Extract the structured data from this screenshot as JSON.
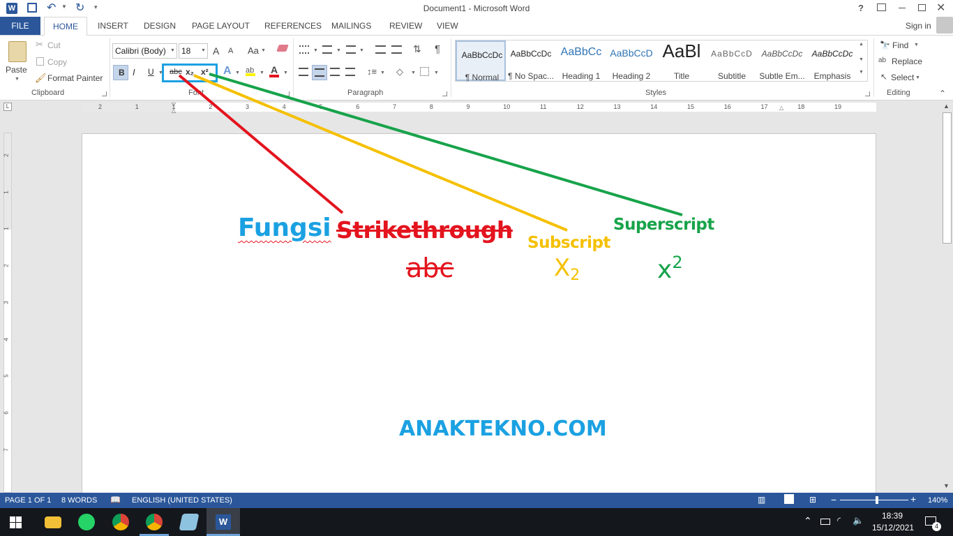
{
  "window": {
    "title": "Document1 - Microsoft Word",
    "help": "?",
    "sign_in": "Sign in"
  },
  "tabs": [
    "FILE",
    "HOME",
    "INSERT",
    "DESIGN",
    "PAGE LAYOUT",
    "REFERENCES",
    "MAILINGS",
    "REVIEW",
    "VIEW"
  ],
  "clipboard": {
    "paste": "Paste",
    "cut": "Cut",
    "copy": "Copy",
    "format_painter": "Format Painter",
    "label": "Clipboard"
  },
  "font": {
    "name": "Calibri (Body)",
    "size": "18",
    "label": "Font",
    "bold": "B",
    "italic": "I",
    "underline": "U",
    "strike": "abc",
    "subscript": "x₂",
    "superscript": "x²",
    "change_case": "Aa",
    "grow": "A",
    "shrink": "A"
  },
  "paragraph": {
    "label": "Paragraph",
    "pilcrow": "¶"
  },
  "styles": {
    "label": "Styles",
    "items": [
      {
        "sample": "AaBbCcDc",
        "name": "¶ Normal"
      },
      {
        "sample": "AaBbCcDc",
        "name": "¶ No Spac..."
      },
      {
        "sample": "AaBbCc",
        "name": "Heading 1"
      },
      {
        "sample": "AaBbCcD",
        "name": "Heading 2"
      },
      {
        "sample": "AaBl",
        "name": "Title"
      },
      {
        "sample": "AaBbCcD",
        "name": "Subtitle"
      },
      {
        "sample": "AaBbCcDc",
        "name": "Subtle Em..."
      },
      {
        "sample": "AaBbCcDc",
        "name": "Emphasis"
      }
    ]
  },
  "editing": {
    "find": "Find",
    "replace": "Replace",
    "select": "Select",
    "label": "Editing"
  },
  "ruler": {
    "marks": [
      "2",
      "1",
      "1",
      "2",
      "3",
      "4",
      "5",
      "6",
      "7",
      "8",
      "9",
      "10",
      "11",
      "12",
      "13",
      "14",
      "15",
      "16",
      "17",
      "18",
      "19"
    ],
    "vmarks": [
      "2",
      "1",
      "1",
      "2",
      "3",
      "4",
      "5",
      "6",
      "7"
    ]
  },
  "document": {
    "fungsi": "Fungsi",
    "strikethrough": "Strikethrough",
    "subscript_label": "Subscript",
    "superscript_label": "Superscript",
    "abc": "abc",
    "x_sub": "X",
    "sub_digit": "2",
    "x_sup": "x",
    "sup_digit": "2",
    "watermark": "ANAKTEKNO.COM",
    "colors": {
      "blue": "#1ba1e2",
      "red": "#e3141e",
      "yellow": "#f5c000",
      "green": "#17a34a",
      "watermark": "#1ba1e2"
    }
  },
  "statusbar": {
    "page": "PAGE 1 OF 1",
    "words": "8 WORDS",
    "language": "ENGLISH (UNITED STATES)",
    "zoom": "140%"
  },
  "taskbar": {
    "time": "18:39",
    "date": "15/12/2021",
    "notifications": "4"
  }
}
